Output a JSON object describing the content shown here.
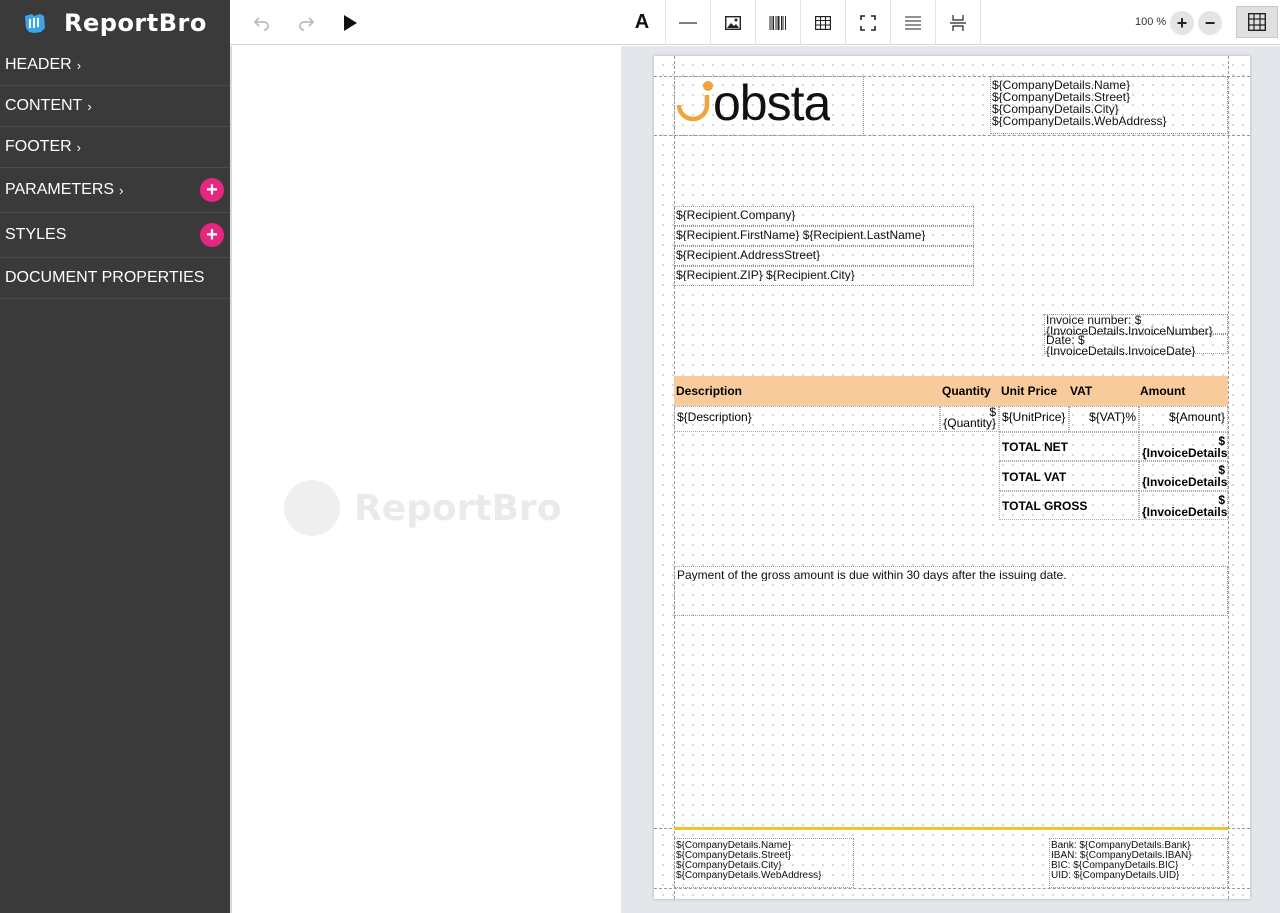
{
  "app": {
    "name": "ReportBro"
  },
  "sidebar": {
    "items": [
      {
        "label": "HEADER",
        "chevron": "›",
        "add": false
      },
      {
        "label": "CONTENT",
        "chevron": "›",
        "add": false
      },
      {
        "label": "FOOTER",
        "chevron": "›",
        "add": false
      },
      {
        "label": "PARAMETERS",
        "chevron": "›",
        "add": true
      },
      {
        "label": "STYLES",
        "chevron": "",
        "add": true
      },
      {
        "label": "DOCUMENT PROPERTIES",
        "chevron": "",
        "add": false
      }
    ],
    "add_symbol": "+"
  },
  "toolbar": {
    "text_tool": "A",
    "zoom": "100 %",
    "zoom_in": "+",
    "zoom_out": "−"
  },
  "watermark": {
    "text": "ReportBro"
  },
  "doc": {
    "logo_text": "obsta",
    "company_header": [
      "${CompanyDetails.Name}",
      "${CompanyDetails.Street}",
      "${CompanyDetails.City}",
      "${CompanyDetails.WebAddress}"
    ],
    "recipient": [
      "${Recipient.Company}",
      "${Recipient.FirstName} ${Recipient.LastName}",
      "${Recipient.AddressStreet}",
      "${Recipient.ZIP} ${Recipient.City}"
    ],
    "invoice_number": [
      "Invoice number: $",
      "{InvoiceDetails.InvoiceNumber}"
    ],
    "invoice_date": [
      "Date: $",
      "{InvoiceDetails.InvoiceDate}"
    ],
    "table_headers": {
      "description": "Description",
      "quantity": "Quantity",
      "unit_price": "Unit Price",
      "vat": "VAT",
      "amount": "Amount"
    },
    "table_row": {
      "description": "${Description}",
      "quantity_a": "$",
      "quantity_b": "{Quantity}",
      "unit_price": "${UnitPrice}",
      "vat": "${VAT}%",
      "amount": "${Amount}"
    },
    "totals": [
      {
        "label": "TOTAL NET",
        "value_a": "$",
        "value_b": "{InvoiceDetails"
      },
      {
        "label": "TOTAL VAT",
        "value_a": "$",
        "value_b": "{InvoiceDetails"
      },
      {
        "label": "TOTAL GROSS",
        "value_a": "$",
        "value_b": "{InvoiceDetails"
      }
    ],
    "payment_note": "Payment of the gross amount is due within 30 days after the issuing date.",
    "footer_company": [
      "${CompanyDetails.Name}",
      "${CompanyDetails.Street}",
      "${CompanyDetails.City}",
      "${CompanyDetails.WebAddress}"
    ],
    "footer_bank": [
      "Bank: ${CompanyDetails.Bank}",
      "IBAN: ${CompanyDetails.IBAN}",
      "BIC: ${CompanyDetails.BIC}",
      "UID: ${CompanyDetails.UID}"
    ]
  },
  "colors": {
    "accent": "#e6267f",
    "logo_orange": "#f2a33a",
    "table_header": "#f8cb9c",
    "footer_rule": "#f2c12e"
  }
}
